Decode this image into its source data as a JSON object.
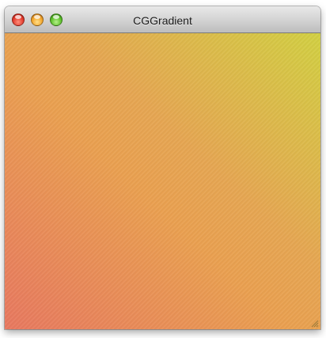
{
  "window": {
    "title": "CGGradient",
    "buttons": {
      "close": "close-icon",
      "minimize": "minimize-icon",
      "zoom": "zoom-icon"
    },
    "gradient_colors": {
      "bottom_left": "#e87860",
      "center": "#eaa050",
      "top_right": "#d2d042"
    }
  }
}
